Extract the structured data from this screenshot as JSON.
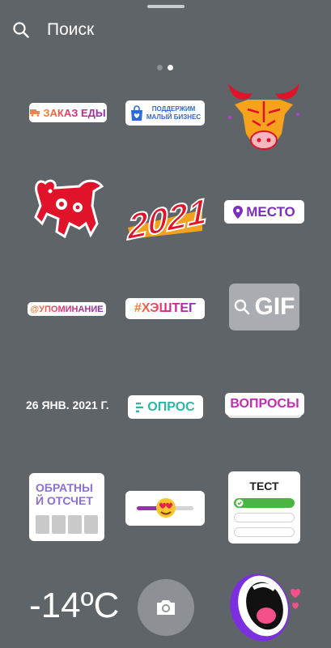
{
  "search": {
    "label": "Поиск"
  },
  "stickers": {
    "food_order": "ЗАКАЗ ЕДЫ",
    "support_small_business": [
      "ПОДДЕРЖИМ",
      "МАЛЫЙ БИЗНЕС"
    ],
    "year": "2021",
    "location": "МЕСТО",
    "mention": "@УПОМИНАНИЕ",
    "hashtag": "#ХЭШТЕГ",
    "gif": "GIF",
    "date": "26 ЯНВ. 2021 Г.",
    "poll": "ОПРОС",
    "questions": "ВОПРОСЫ",
    "countdown": [
      "ОБРАТНЫ",
      "Й ОТСЧЕТ"
    ],
    "quiz": "ТЕСТ",
    "temperature": "-14ºC"
  },
  "colors": {
    "background": "#5f6468",
    "accent_red": "#e0132a",
    "poll_teal": "#2db7a6"
  },
  "pager": {
    "pages": 2,
    "active": 2
  }
}
